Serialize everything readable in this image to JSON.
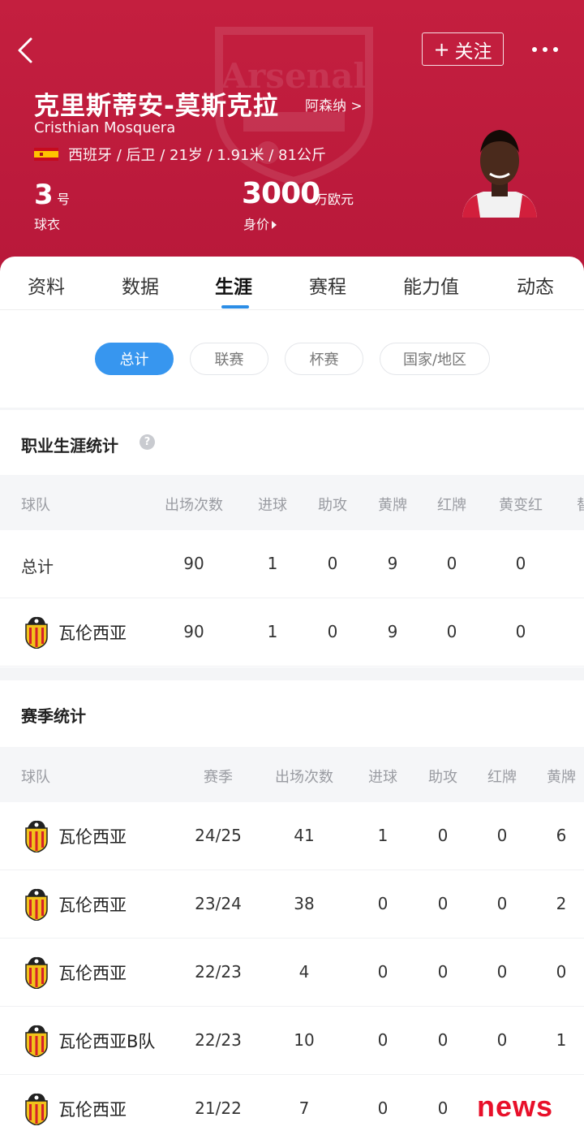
{
  "header": {
    "name_cn": "克里斯蒂安-莫斯克拉",
    "club_link": "阿森纳 >",
    "name_en": "Cristhian Mosquera",
    "info": "西班牙 / 后卫 / 21岁 / 1.91米 / 81公斤",
    "follow_label": "关注",
    "follow_icon": "+",
    "shirt_number": "3",
    "shirt_unit": "号",
    "shirt_label": "球衣",
    "market_value": "3000",
    "market_value_unit": "万欧元",
    "market_value_label": "身价",
    "crest_text": "Arsenal",
    "accent_color": "#c41f3f"
  },
  "tabs": [
    "资料",
    "数据",
    "生涯",
    "赛程",
    "能力值",
    "动态"
  ],
  "active_tab": "生涯",
  "filters": [
    "总计",
    "联赛",
    "杯赛",
    "国家/地区"
  ],
  "active_filter": "总计",
  "career": {
    "title": "职业生涯统计",
    "columns": [
      "球队",
      "出场次数",
      "进球",
      "助攻",
      "黄牌",
      "红牌",
      "黄变红",
      "替"
    ],
    "rows": [
      {
        "team": "总计",
        "apps": "90",
        "goals": "1",
        "assists": "0",
        "yellow": "9",
        "red": "0",
        "y2r": "0"
      },
      {
        "team": "瓦伦西亚",
        "apps": "90",
        "goals": "1",
        "assists": "0",
        "yellow": "9",
        "red": "0",
        "y2r": "0"
      }
    ]
  },
  "season": {
    "title": "赛季统计",
    "columns": [
      "球队",
      "赛季",
      "出场次数",
      "进球",
      "助攻",
      "红牌",
      "黄牌"
    ],
    "rows": [
      {
        "team": "瓦伦西亚",
        "season": "24/25",
        "apps": "41",
        "goals": "1",
        "assists": "0",
        "red": "0",
        "yellow": "6"
      },
      {
        "team": "瓦伦西亚",
        "season": "23/24",
        "apps": "38",
        "goals": "0",
        "assists": "0",
        "red": "0",
        "yellow": "2"
      },
      {
        "team": "瓦伦西亚",
        "season": "22/23",
        "apps": "4",
        "goals": "0",
        "assists": "0",
        "red": "0",
        "yellow": "0"
      },
      {
        "team": "瓦伦西亚B队",
        "season": "22/23",
        "apps": "10",
        "goals": "0",
        "assists": "0",
        "red": "0",
        "yellow": "1"
      },
      {
        "team": "瓦伦西亚",
        "season": "21/22",
        "apps": "7",
        "goals": "0",
        "assists": "0",
        "red": "",
        "yellow": ""
      }
    ]
  },
  "watermark": "news"
}
